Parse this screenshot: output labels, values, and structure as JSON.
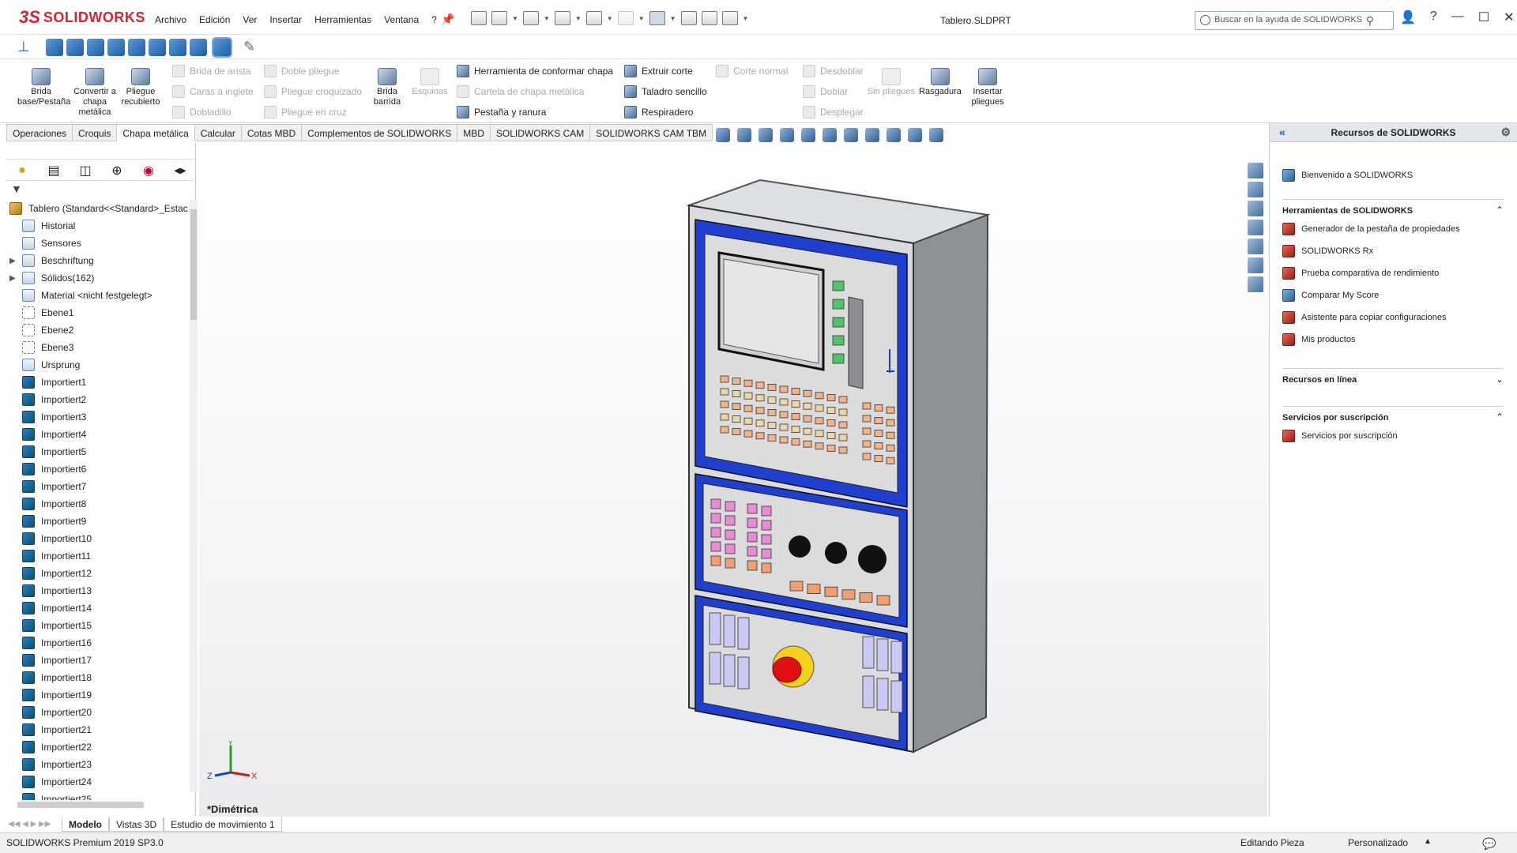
{
  "app": {
    "logo_prefix": "3S",
    "logo_name": "SOLIDWORKS",
    "menus": [
      "Archivo",
      "Edición",
      "Ver",
      "Insertar",
      "Herramientas",
      "Ventana",
      "?"
    ],
    "doc_title": "Tablero.SLDPRT",
    "search_placeholder": "Buscar en la ayuda de SOLIDWORKS"
  },
  "command_manager": {
    "big_left": [
      {
        "label": "Brida base/Pestaña"
      },
      {
        "label": "Convertir a chapa metálica"
      },
      {
        "label": "Pliegue recubierto"
      }
    ],
    "small_col1": [
      "Brida de arista",
      "Caras a inglete",
      "Dobladillo"
    ],
    "small_col2": [
      "Doble pliegue",
      "Pliegue croquizado",
      "Pliegue en cruz"
    ],
    "brida_barrida": "Brida barrida",
    "esquinas": "Esquinas",
    "small_col3": [
      "Herramienta de conformar chapa",
      "Cartela de chapa metálica",
      "Pestaña y ranura"
    ],
    "small_col4": [
      "Extruir corte",
      "Taladro sencillo",
      "Respiradero"
    ],
    "corte_normal": "Corte normal",
    "small_col5": [
      "Desdoblar",
      "Doblar",
      "Desplegar"
    ],
    "sin_pliegues": "Sin pliegues",
    "rasgadura": "Rasgadura",
    "insertar_pliegues": "Insertar pliegues"
  },
  "tabs": [
    "Operaciones",
    "Croquis",
    "Chapa metálica",
    "Calcular",
    "Cotas MBD",
    "Complementos de SOLIDWORKS",
    "MBD",
    "SOLIDWORKS CAM",
    "SOLIDWORKS CAM TBM"
  ],
  "active_tab": "Chapa metálica",
  "feature_tree": {
    "root": "Tablero  (Standard<<Standard>_Estac",
    "nodes": [
      {
        "label": "Historial",
        "kind": "folder"
      },
      {
        "label": "Sensores",
        "kind": "folder"
      },
      {
        "label": "Beschriftung",
        "kind": "folder",
        "expandable": true
      },
      {
        "label": "Sólidos(162)",
        "kind": "folder",
        "expandable": true
      },
      {
        "label": "Material <nicht festgelegt>",
        "kind": "folder"
      },
      {
        "label": "Ebene1",
        "kind": "ref"
      },
      {
        "label": "Ebene2",
        "kind": "ref"
      },
      {
        "label": "Ebene3",
        "kind": "ref"
      },
      {
        "label": "Ursprung",
        "kind": "origin"
      },
      {
        "label": "Importiert1",
        "kind": "solid"
      },
      {
        "label": "Importiert2",
        "kind": "solid"
      },
      {
        "label": "Importiert3",
        "kind": "solid"
      },
      {
        "label": "Importiert4",
        "kind": "solid"
      },
      {
        "label": "Importiert5",
        "kind": "solid"
      },
      {
        "label": "Importiert6",
        "kind": "solid"
      },
      {
        "label": "Importiert7",
        "kind": "solid"
      },
      {
        "label": "Importiert8",
        "kind": "solid"
      },
      {
        "label": "Importiert9",
        "kind": "solid"
      },
      {
        "label": "Importiert10",
        "kind": "solid"
      },
      {
        "label": "Importiert11",
        "kind": "solid"
      },
      {
        "label": "Importiert12",
        "kind": "solid"
      },
      {
        "label": "Importiert13",
        "kind": "solid"
      },
      {
        "label": "Importiert14",
        "kind": "solid"
      },
      {
        "label": "Importiert15",
        "kind": "solid"
      },
      {
        "label": "Importiert16",
        "kind": "solid"
      },
      {
        "label": "Importiert17",
        "kind": "solid"
      },
      {
        "label": "Importiert18",
        "kind": "solid"
      },
      {
        "label": "Importiert19",
        "kind": "solid"
      },
      {
        "label": "Importiert20",
        "kind": "solid"
      },
      {
        "label": "Importiert21",
        "kind": "solid"
      },
      {
        "label": "Importiert22",
        "kind": "solid"
      },
      {
        "label": "Importiert23",
        "kind": "solid"
      },
      {
        "label": "Importiert24",
        "kind": "solid"
      },
      {
        "label": "Importiert25",
        "kind": "solid"
      }
    ]
  },
  "viewport": {
    "view_name": "*Dimétrica",
    "triad": {
      "x": "X",
      "y": "Y",
      "z": "Z"
    }
  },
  "task_pane": {
    "title": "Recursos de SOLIDWORKS",
    "welcome": "Bienvenido a SOLIDWORKS",
    "tools_header": "Herramientas de SOLIDWORKS",
    "tools": [
      "Generador de la pestaña de propiedades",
      "SOLIDWORKS Rx",
      "Prueba comparativa de rendimiento",
      "Comparar My Score",
      "Asistente para copiar configuraciones",
      "Mis productos"
    ],
    "online_header": "Recursos en línea",
    "subscription_header": "Servicios por suscripción",
    "subscription_item": "Servicios por suscripción"
  },
  "bottom_tabs": [
    "Modelo",
    "Vistas 3D",
    "Estudio de movimiento 1"
  ],
  "status": {
    "left": "SOLIDWORKS Premium 2019 SP3.0",
    "mode": "Editando Pieza",
    "units": "Personalizado"
  },
  "colors": {
    "brand": "#d6232f",
    "panel_blue": "#1f3fd0",
    "estop_red": "#e01010",
    "estop_yellow": "#f2d21a"
  }
}
